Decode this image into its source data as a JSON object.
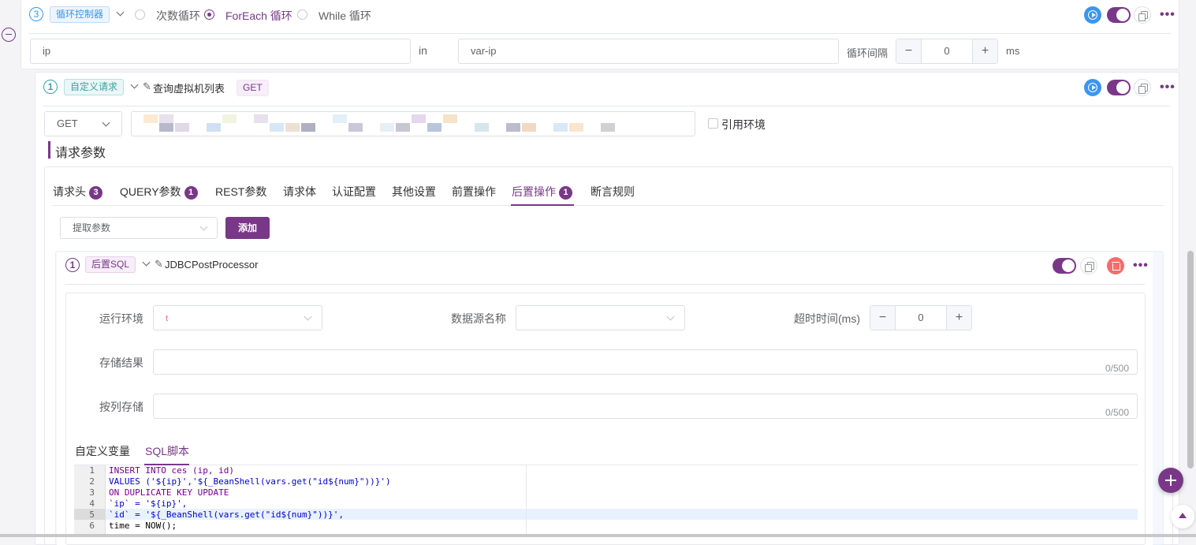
{
  "loop_controller": {
    "index": "3",
    "tag": "循环控制器",
    "radio_count_loop": "次数循环",
    "radio_foreach": "ForEach 循环",
    "radio_while": "While 循环",
    "variable": "ip",
    "in_label": "in",
    "collection": "var-ip",
    "interval_label": "循环间隔",
    "interval_value": "0",
    "interval_unit": "ms",
    "minus": "−",
    "plus": "+"
  },
  "request": {
    "index": "1",
    "tag": "自定义请求",
    "name": "查询虚拟机列表",
    "method_badge": "GET",
    "method": "GET",
    "use_env": "引用环境"
  },
  "params_title": "请求参数",
  "tabs": [
    {
      "label": "请求头",
      "badge": "3"
    },
    {
      "label": "QUERY参数",
      "badge": "1"
    },
    {
      "label": "REST参数"
    },
    {
      "label": "请求体"
    },
    {
      "label": "认证配置"
    },
    {
      "label": "其他设置"
    },
    {
      "label": "前置操作"
    },
    {
      "label": "后置操作",
      "badge": "1"
    },
    {
      "label": "断言规则"
    }
  ],
  "extract": {
    "placeholder": "提取参数",
    "add_button": "添加"
  },
  "post_sql": {
    "index": "1",
    "tag": "后置SQL",
    "name": "JDBCPostProcessor",
    "env_label": "运行环境",
    "env_value": "t",
    "datasource_label": "数据源名称",
    "timeout_label": "超时时间(ms)",
    "timeout_value": "0",
    "store_result_label": "存储结果",
    "store_column_label": "按列存储",
    "counter": "0/500",
    "tab_custom_vars": "自定义变量",
    "tab_sql_script": "SQL脚本",
    "sql_lines": [
      "INSERT INTO ces (ip, id)",
      "VALUES ('${ip}','${_BeanShell(vars.get(\"id${num}\"))}')",
      "ON DUPLICATE KEY UPDATE",
      "`ip` = '${ip}',",
      "`id` = '${_BeanShell(vars.get(\"id${num}\"))}',",
      "time = NOW();"
    ],
    "line_numbers": [
      "1",
      "2",
      "3",
      "4",
      "5",
      "6"
    ]
  },
  "colors": {
    "primary": "#783887",
    "blue": "#3a96ef",
    "teal": "#37a2a1",
    "danger": "#f56c6c"
  }
}
